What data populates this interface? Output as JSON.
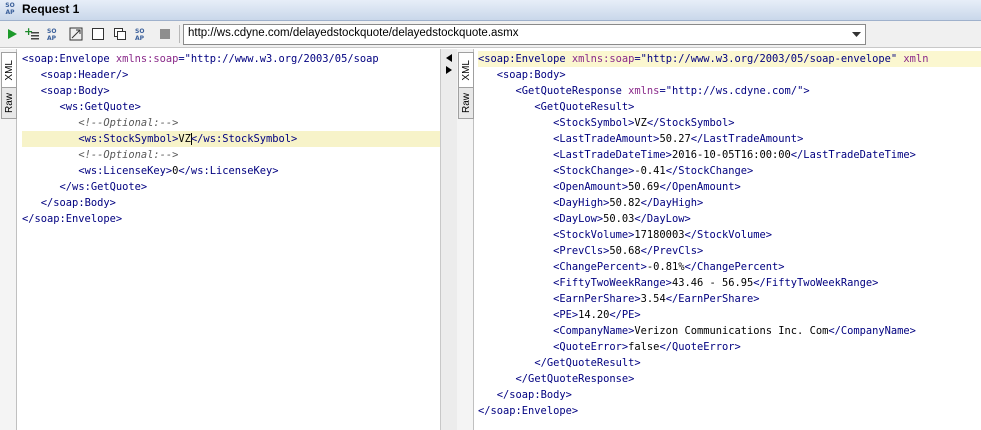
{
  "window": {
    "title": "Request 1",
    "icon": "soap-request-icon"
  },
  "toolbar": {
    "url": "http://ws.cdyne.com/delayedstockquote/delayedstockquote.asmx",
    "buttons": [
      "run-icon",
      "add-assertion-icon",
      "ws-a-icon",
      "expand-icon",
      "checkbox-icon",
      "copy-icon",
      "soap-icon",
      "stop-icon"
    ]
  },
  "request_tabs": {
    "xml": "XML",
    "raw": "Raw"
  },
  "response_tabs": {
    "xml": "XML",
    "raw": "Raw"
  },
  "request_lines": [
    {
      "indent": "",
      "parts": [
        [
          "tag",
          "<soap:Envelope "
        ],
        [
          "att",
          "xmlns:soap"
        ],
        [
          "tag",
          "="
        ],
        [
          "val",
          "\"http://www.w3.org/2003/05/soap"
        ]
      ]
    },
    {
      "indent": "   ",
      "parts": [
        [
          "tag",
          "<soap:Header/>"
        ]
      ]
    },
    {
      "indent": "   ",
      "parts": [
        [
          "tag",
          "<soap:Body>"
        ]
      ]
    },
    {
      "indent": "      ",
      "parts": [
        [
          "tag",
          "<ws:GetQuote>"
        ]
      ]
    },
    {
      "indent": "         ",
      "parts": [
        [
          "cmt",
          "<!--Optional:-->"
        ]
      ]
    },
    {
      "indent": "         ",
      "parts": [
        [
          "tag",
          "<ws:StockSymbol>"
        ],
        [
          "txt",
          "VZ"
        ],
        [
          "caret",
          ""
        ],
        [
          "tag",
          "</ws:StockSymbol>"
        ]
      ],
      "hl": true
    },
    {
      "indent": "         ",
      "parts": [
        [
          "cmt",
          "<!--Optional:-->"
        ]
      ]
    },
    {
      "indent": "         ",
      "parts": [
        [
          "tag",
          "<ws:LicenseKey>"
        ],
        [
          "txt",
          "0"
        ],
        [
          "tag",
          "</ws:LicenseKey>"
        ]
      ]
    },
    {
      "indent": "      ",
      "parts": [
        [
          "tag",
          "</ws:GetQuote>"
        ]
      ]
    },
    {
      "indent": "   ",
      "parts": [
        [
          "tag",
          "</soap:Body>"
        ]
      ]
    },
    {
      "indent": "",
      "parts": [
        [
          "tag",
          "</soap:Envelope>"
        ]
      ]
    }
  ],
  "response_lines": [
    {
      "indent": "",
      "parts": [
        [
          "tag",
          "<soap:Envelope "
        ],
        [
          "att",
          "xmlns:soap"
        ],
        [
          "tag",
          "="
        ],
        [
          "val",
          "\"http://www.w3.org/2003/05/soap-envelope\" "
        ],
        [
          "att",
          "xmln"
        ]
      ],
      "hl": true
    },
    {
      "indent": "   ",
      "parts": [
        [
          "tag",
          "<soap:Body>"
        ]
      ]
    },
    {
      "indent": "      ",
      "parts": [
        [
          "tag",
          "<GetQuoteResponse "
        ],
        [
          "att",
          "xmlns"
        ],
        [
          "tag",
          "="
        ],
        [
          "val",
          "\"http://ws.cdyne.com/\""
        ],
        [
          "tag",
          ">"
        ]
      ]
    },
    {
      "indent": "         ",
      "parts": [
        [
          "tag",
          "<GetQuoteResult>"
        ]
      ]
    },
    {
      "indent": "            ",
      "parts": [
        [
          "tag",
          "<StockSymbol>"
        ],
        [
          "txt",
          "VZ"
        ],
        [
          "tag",
          "</StockSymbol>"
        ]
      ]
    },
    {
      "indent": "            ",
      "parts": [
        [
          "tag",
          "<LastTradeAmount>"
        ],
        [
          "txt",
          "50.27"
        ],
        [
          "tag",
          "</LastTradeAmount>"
        ]
      ]
    },
    {
      "indent": "            ",
      "parts": [
        [
          "tag",
          "<LastTradeDateTime>"
        ],
        [
          "txt",
          "2016-10-05T16:00:00"
        ],
        [
          "tag",
          "</LastTradeDateTime>"
        ]
      ]
    },
    {
      "indent": "            ",
      "parts": [
        [
          "tag",
          "<StockChange>"
        ],
        [
          "txt",
          "-0.41"
        ],
        [
          "tag",
          "</StockChange>"
        ]
      ]
    },
    {
      "indent": "            ",
      "parts": [
        [
          "tag",
          "<OpenAmount>"
        ],
        [
          "txt",
          "50.69"
        ],
        [
          "tag",
          "</OpenAmount>"
        ]
      ]
    },
    {
      "indent": "            ",
      "parts": [
        [
          "tag",
          "<DayHigh>"
        ],
        [
          "txt",
          "50.82"
        ],
        [
          "tag",
          "</DayHigh>"
        ]
      ]
    },
    {
      "indent": "            ",
      "parts": [
        [
          "tag",
          "<DayLow>"
        ],
        [
          "txt",
          "50.03"
        ],
        [
          "tag",
          "</DayLow>"
        ]
      ]
    },
    {
      "indent": "            ",
      "parts": [
        [
          "tag",
          "<StockVolume>"
        ],
        [
          "txt",
          "17180003"
        ],
        [
          "tag",
          "</StockVolume>"
        ]
      ]
    },
    {
      "indent": "            ",
      "parts": [
        [
          "tag",
          "<PrevCls>"
        ],
        [
          "txt",
          "50.68"
        ],
        [
          "tag",
          "</PrevCls>"
        ]
      ]
    },
    {
      "indent": "            ",
      "parts": [
        [
          "tag",
          "<ChangePercent>"
        ],
        [
          "txt",
          "-0.81%"
        ],
        [
          "tag",
          "</ChangePercent>"
        ]
      ]
    },
    {
      "indent": "            ",
      "parts": [
        [
          "tag",
          "<FiftyTwoWeekRange>"
        ],
        [
          "txt",
          "43.46 - 56.95"
        ],
        [
          "tag",
          "</FiftyTwoWeekRange>"
        ]
      ]
    },
    {
      "indent": "            ",
      "parts": [
        [
          "tag",
          "<EarnPerShare>"
        ],
        [
          "txt",
          "3.54"
        ],
        [
          "tag",
          "</EarnPerShare>"
        ]
      ]
    },
    {
      "indent": "            ",
      "parts": [
        [
          "tag",
          "<PE>"
        ],
        [
          "txt",
          "14.20"
        ],
        [
          "tag",
          "</PE>"
        ]
      ]
    },
    {
      "indent": "            ",
      "parts": [
        [
          "tag",
          "<CompanyName>"
        ],
        [
          "txt",
          "Verizon Communications Inc. Com"
        ],
        [
          "tag",
          "</CompanyName>"
        ]
      ]
    },
    {
      "indent": "            ",
      "parts": [
        [
          "tag",
          "<QuoteError>"
        ],
        [
          "txt",
          "false"
        ],
        [
          "tag",
          "</QuoteError>"
        ]
      ]
    },
    {
      "indent": "         ",
      "parts": [
        [
          "tag",
          "</GetQuoteResult>"
        ]
      ]
    },
    {
      "indent": "      ",
      "parts": [
        [
          "tag",
          "</GetQuoteResponse>"
        ]
      ]
    },
    {
      "indent": "   ",
      "parts": [
        [
          "tag",
          "</soap:Body>"
        ]
      ]
    },
    {
      "indent": "",
      "parts": [
        [
          "tag",
          "</soap:Envelope>"
        ]
      ]
    }
  ]
}
